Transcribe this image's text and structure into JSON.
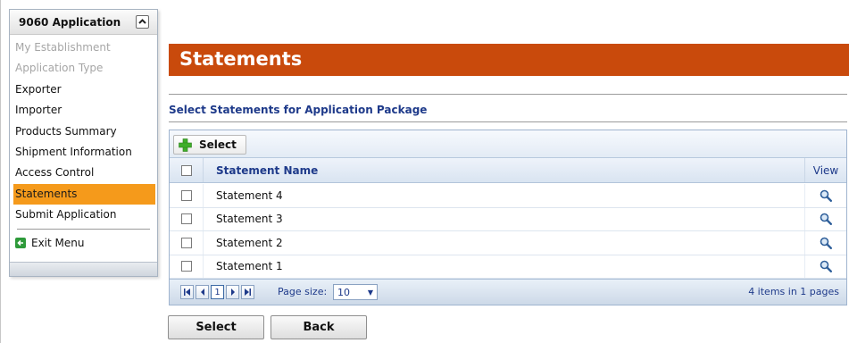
{
  "menu": {
    "title": "9060 Application",
    "items": [
      {
        "label": "My Establishment",
        "state": "disabled"
      },
      {
        "label": "Application Type",
        "state": "disabled"
      },
      {
        "label": "Exporter",
        "state": "normal"
      },
      {
        "label": "Importer",
        "state": "normal"
      },
      {
        "label": "Products Summary",
        "state": "normal"
      },
      {
        "label": "Shipment Information",
        "state": "normal"
      },
      {
        "label": "Access Control",
        "state": "normal"
      },
      {
        "label": "Statements",
        "state": "active"
      },
      {
        "label": "Submit Application",
        "state": "normal"
      }
    ],
    "exit_label": "Exit Menu",
    "collapse_icon": "chevron-up-icon",
    "exit_icon": "exit-arrow-icon"
  },
  "page": {
    "title": "Statements",
    "section_title": "Select Statements for Application Package"
  },
  "grid": {
    "toolbar_select_label": "Select",
    "toolbar_icon": "plus-icon",
    "columns": {
      "name": "Statement Name",
      "view": "View"
    },
    "rows": [
      {
        "name": "Statement 4",
        "checked": false
      },
      {
        "name": "Statement 3",
        "checked": false
      },
      {
        "name": "Statement 2",
        "checked": false
      },
      {
        "name": "Statement 1",
        "checked": false
      }
    ],
    "view_icon": "magnifier-icon",
    "pager": {
      "first": "◀◀",
      "prev": "◀",
      "current_page": "1",
      "next": "▶",
      "last": "▶▶",
      "page_size_label": "Page size:",
      "page_size": "10",
      "info": "4 items in 1 pages"
    }
  },
  "actions": {
    "select_label": "Select",
    "back_label": "Back"
  },
  "colors": {
    "accent_orange": "#f59a1b",
    "title_bar": "#c94a0c",
    "link_blue": "#1e3a8a"
  }
}
